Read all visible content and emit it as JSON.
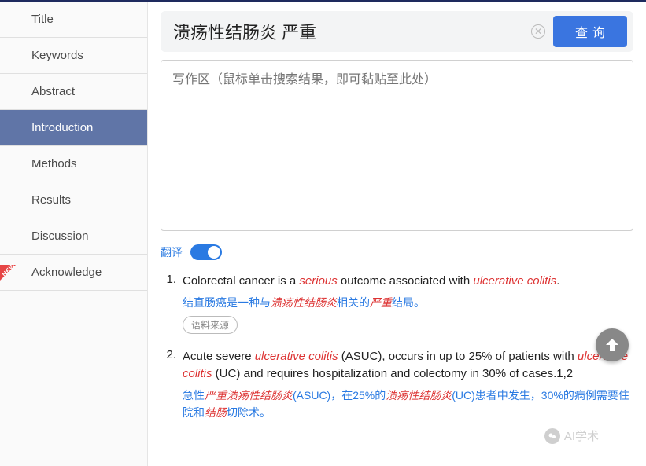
{
  "sidebar": {
    "items": [
      {
        "label": "Title"
      },
      {
        "label": "Keywords"
      },
      {
        "label": "Abstract"
      },
      {
        "label": "Introduction"
      },
      {
        "label": "Methods"
      },
      {
        "label": "Results"
      },
      {
        "label": "Discussion"
      },
      {
        "label": "Acknowledge"
      }
    ],
    "active_index": 3,
    "new_badge_text": "NEW"
  },
  "search": {
    "value": "溃疡性结肠炎 严重",
    "button_label": "查询"
  },
  "writing_area": {
    "placeholder": "写作区（鼠标单击搜索结果，即可黏贴至此处）"
  },
  "translate": {
    "label": "翻译",
    "on": true
  },
  "results": [
    {
      "num": "1.",
      "en_parts": [
        {
          "t": "Colorectal cancer is a ",
          "hl": false
        },
        {
          "t": "serious",
          "hl": true
        },
        {
          "t": " outcome associated with ",
          "hl": false
        },
        {
          "t": "ulcerative colitis",
          "hl": true
        },
        {
          "t": ".",
          "hl": false
        }
      ],
      "cn_parts": [
        {
          "t": "结直肠癌是一种与",
          "hl": false
        },
        {
          "t": "溃疡性结肠炎",
          "hl": true
        },
        {
          "t": "相关的",
          "hl": false
        },
        {
          "t": "严重",
          "hl": true
        },
        {
          "t": "结局。",
          "hl": false
        }
      ],
      "source_label": "语料来源"
    },
    {
      "num": "2.",
      "en_parts": [
        {
          "t": "Acute severe ",
          "hl": false
        },
        {
          "t": "ulcerative colitis",
          "hl": true
        },
        {
          "t": " (ASUC), occurs in up to 25% of patients with ",
          "hl": false
        },
        {
          "t": "ulcerative colitis",
          "hl": true
        },
        {
          "t": " (UC) and requires hospitalization and colectomy in 30% of cases.1,2",
          "hl": false
        }
      ],
      "cn_parts": [
        {
          "t": "急性",
          "hl": false
        },
        {
          "t": "严重溃疡性结肠炎",
          "hl": true
        },
        {
          "t": "(ASUC)，在25%的",
          "hl": false
        },
        {
          "t": "溃疡性结肠炎",
          "hl": true
        },
        {
          "t": "(UC)患者中发生，30%的病例需要住院和",
          "hl": false
        },
        {
          "t": "结肠",
          "hl": true
        },
        {
          "t": "切除术。",
          "hl": false
        }
      ]
    }
  ],
  "watermark": {
    "text": "AI学术"
  }
}
